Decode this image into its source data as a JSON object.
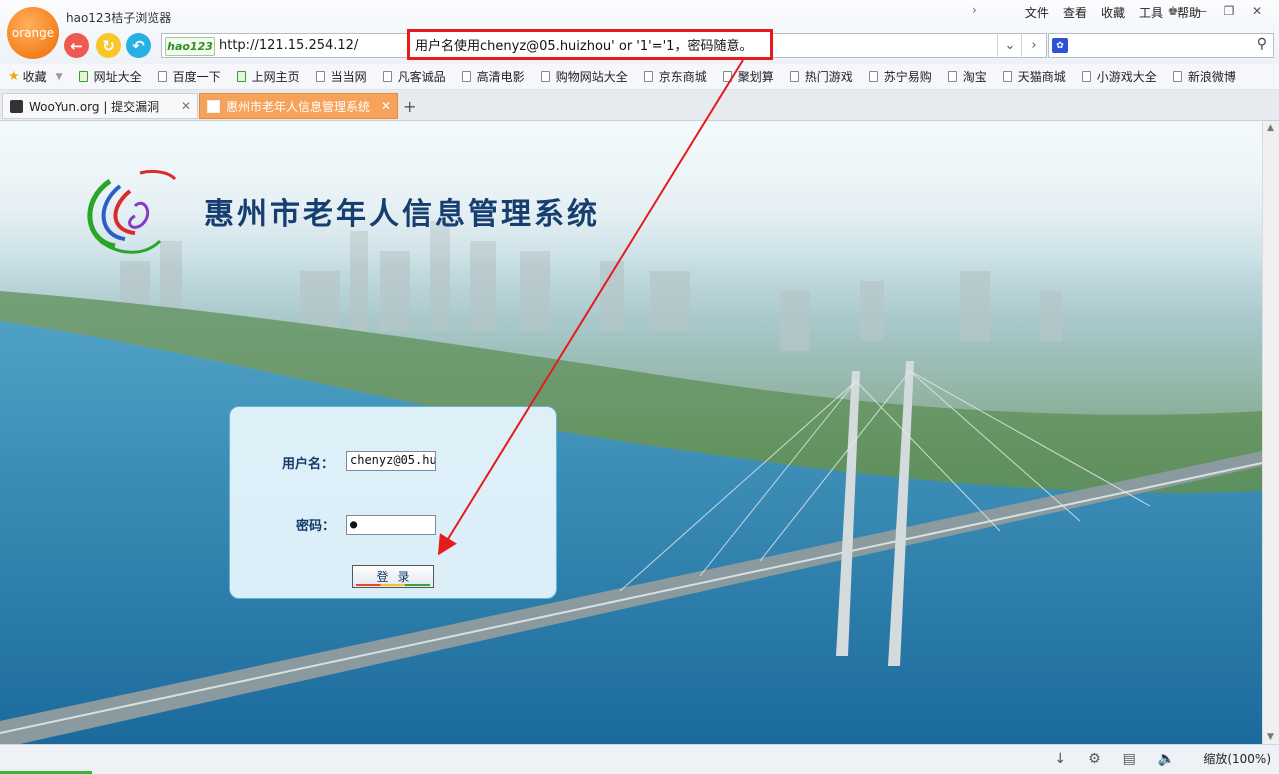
{
  "app": {
    "logo_text": "orange",
    "title": "hao123桔子浏览器"
  },
  "menu": {
    "items": [
      "文件",
      "查看",
      "收藏",
      "工具",
      "帮助"
    ]
  },
  "address_bar": {
    "brand": "hao123",
    "url": "http://121.15.254.12/"
  },
  "bookmarks": {
    "favorites_label": "收藏",
    "items": [
      {
        "label": "网址大全",
        "icon": "hao-icon"
      },
      {
        "label": "百度一下",
        "icon": "page-icon"
      },
      {
        "label": "上网主页",
        "icon": "hao-icon"
      },
      {
        "label": "当当网",
        "icon": "page-icon"
      },
      {
        "label": "凡客诚品",
        "icon": "page-icon"
      },
      {
        "label": "高清电影",
        "icon": "page-icon"
      },
      {
        "label": "购物网站大全",
        "icon": "page-icon"
      },
      {
        "label": "京东商城",
        "icon": "page-icon"
      },
      {
        "label": "聚划算",
        "icon": "page-icon"
      },
      {
        "label": "热门游戏",
        "icon": "page-icon"
      },
      {
        "label": "苏宁易购",
        "icon": "page-icon"
      },
      {
        "label": "淘宝",
        "icon": "page-icon"
      },
      {
        "label": "天猫商城",
        "icon": "page-icon"
      },
      {
        "label": "小游戏大全",
        "icon": "page-icon"
      },
      {
        "label": "新浪微博",
        "icon": "page-icon"
      }
    ]
  },
  "tabs": [
    {
      "label": "WooYun.org | 提交漏洞",
      "active": false
    },
    {
      "label": "惠州市老年人信息管理系统",
      "active": true
    }
  ],
  "page": {
    "system_title": "惠州市老年人信息管理系统",
    "login": {
      "username_label": "用户名：",
      "username_value": "chenyz@05.hu",
      "password_label": "密码：",
      "password_value": "●",
      "submit_label": "登录"
    }
  },
  "annotation": {
    "text": "用户名使用chenyz@05.huizhou' or '1'='1，密码随意。",
    "color": "#e41c1c"
  },
  "status_bar": {
    "zoom": "缩放(100%)"
  },
  "colors": {
    "active_tab": "#f7a25a",
    "title_blue": "#163e6e",
    "accent_red": "#e41c1c"
  }
}
